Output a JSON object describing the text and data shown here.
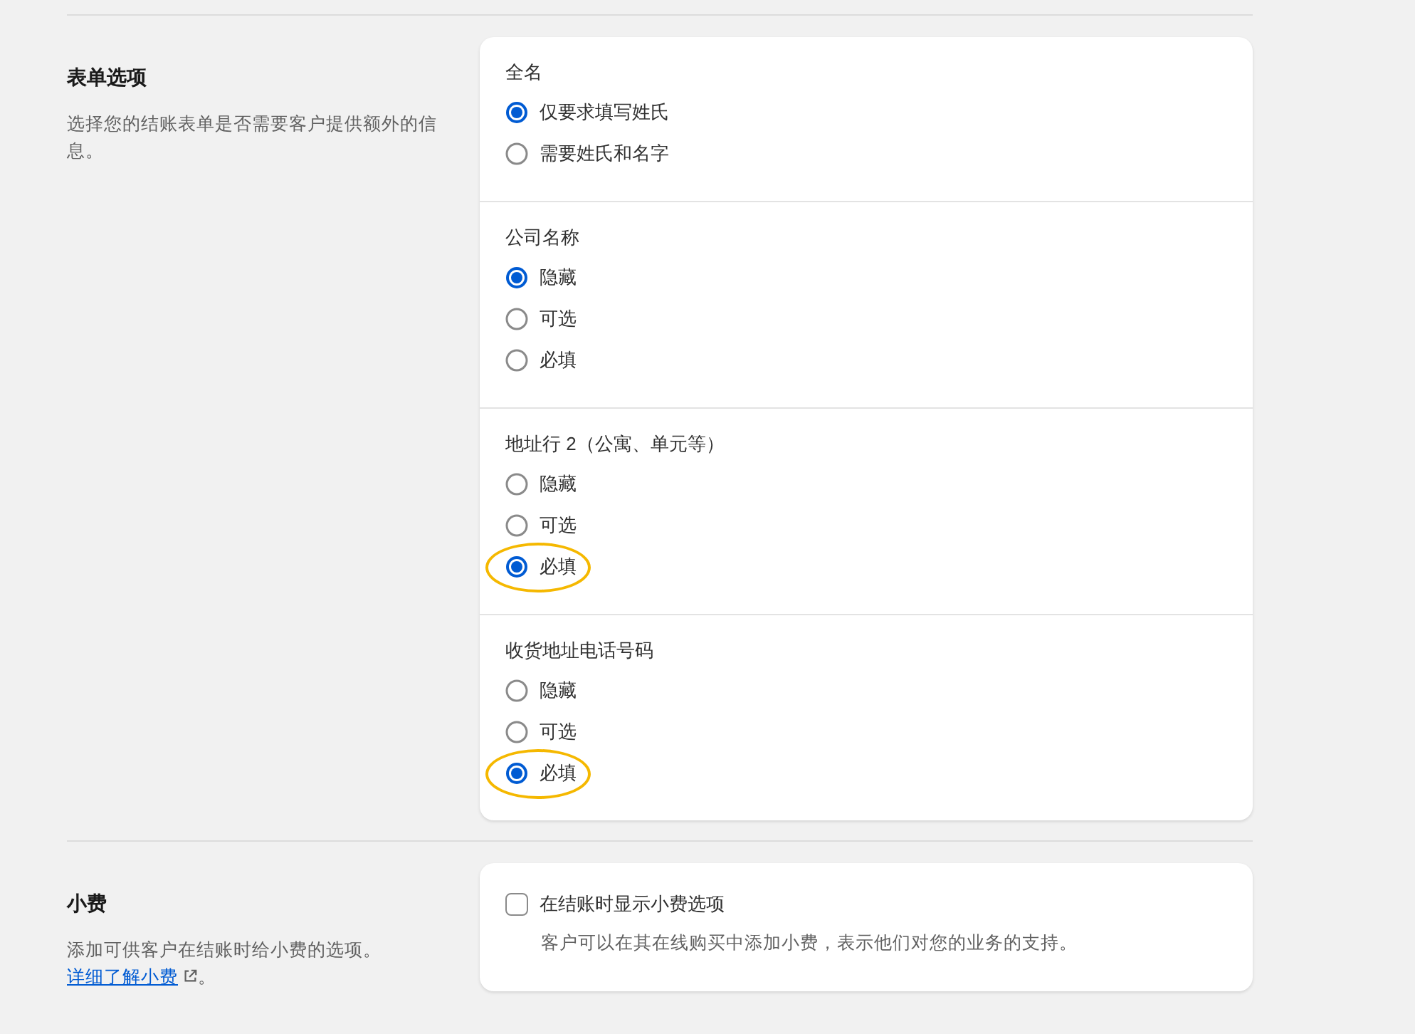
{
  "sections": [
    {
      "title": "表单选项",
      "description": "选择您的结账表单是否需要客户提供额外的信息。",
      "card": {
        "kind": "radio_groups",
        "groups": [
          {
            "label": "全名",
            "options": [
              {
                "label": "仅要求填写姓氏",
                "selected": true,
                "highlighted": false
              },
              {
                "label": "需要姓氏和名字",
                "selected": false,
                "highlighted": false
              }
            ]
          },
          {
            "label": "公司名称",
            "options": [
              {
                "label": "隐藏",
                "selected": true,
                "highlighted": false
              },
              {
                "label": "可选",
                "selected": false,
                "highlighted": false
              },
              {
                "label": "必填",
                "selected": false,
                "highlighted": false
              }
            ]
          },
          {
            "label": "地址行 2（公寓、单元等）",
            "options": [
              {
                "label": "隐藏",
                "selected": false,
                "highlighted": false
              },
              {
                "label": "可选",
                "selected": false,
                "highlighted": false
              },
              {
                "label": "必填",
                "selected": true,
                "highlighted": true
              }
            ]
          },
          {
            "label": "收货地址电话号码",
            "options": [
              {
                "label": "隐藏",
                "selected": false,
                "highlighted": false
              },
              {
                "label": "可选",
                "selected": false,
                "highlighted": false
              },
              {
                "label": "必填",
                "selected": true,
                "highlighted": true
              }
            ]
          }
        ]
      }
    },
    {
      "title": "小费",
      "description": "添加可供客户在结账时给小费的选项。",
      "link": "详细了解小费",
      "after_link": "。",
      "card": {
        "kind": "checkbox",
        "label": "在结账时显示小费选项",
        "checked": false,
        "help": "客户可以在其在线购买中添加小费，表示他们对您的业务的支持。"
      }
    }
  ]
}
